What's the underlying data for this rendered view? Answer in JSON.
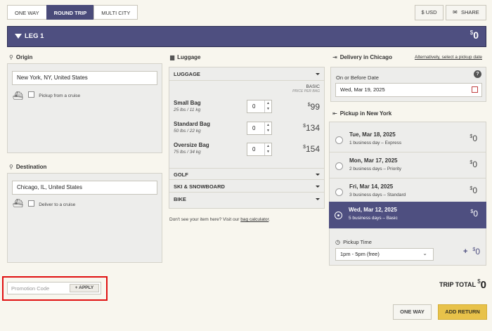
{
  "trip_tabs": [
    {
      "label": "ONE WAY",
      "active": false
    },
    {
      "label": "ROUND TRIP",
      "active": true
    },
    {
      "label": "MULTI CITY",
      "active": false
    }
  ],
  "currency_label": "$ USD",
  "share_label": "SHARE",
  "leg": {
    "title": "LEG 1",
    "price": "0",
    "currency_symbol": "$"
  },
  "origin": {
    "title": "Origin",
    "value": "New York, NY, United States",
    "cruise_label": "Pickup from a cruise"
  },
  "destination": {
    "title": "Destination",
    "value": "Chicago, IL, United States",
    "cruise_label": "Deliver to a cruise"
  },
  "luggage": {
    "title": "Luggage",
    "category": "LUGGAGE",
    "tier_label": "BASIC",
    "tier_sub": "PRICE PER BAG",
    "items": [
      {
        "name": "Small Bag",
        "weight": "25 lbs / 11 kg",
        "qty": "0",
        "price": "99"
      },
      {
        "name": "Standard Bag",
        "weight": "50 lbs / 22 kg",
        "qty": "0",
        "price": "134"
      },
      {
        "name": "Oversize Bag",
        "weight": "75 lbs / 34 kg",
        "qty": "0",
        "price": "154"
      }
    ],
    "other_categories": [
      "GOLF",
      "SKI & SNOWBOARD",
      "BIKE"
    ],
    "note_prefix": "Don't see your item here? Visit our",
    "note_link": "bag calculator",
    "note_suffix": "."
  },
  "delivery": {
    "title": "Delivery in Chicago",
    "alt_link": "Alternatively, select a pickup date",
    "label": "On or Before Date",
    "date_value": "Wed, Mar 19, 2025",
    "help": "?"
  },
  "pickup": {
    "title": "Pickup in New York",
    "options": [
      {
        "date": "Tue, Mar 18, 2025",
        "desc": "1 business day – Express",
        "price": "0",
        "selected": false
      },
      {
        "date": "Mon, Mar 17, 2025",
        "desc": "2 business days – Priority",
        "price": "0",
        "selected": false
      },
      {
        "date": "Fri, Mar 14, 2025",
        "desc": "3 business days – Standard",
        "price": "0",
        "selected": false
      },
      {
        "date": "Wed, Mar 12, 2025",
        "desc": "5 business days – Basic",
        "price": "0",
        "selected": true
      }
    ],
    "time_label": "Pickup Time",
    "time_value": "1pm - 5pm (free)",
    "time_plus": "+",
    "time_price": "0"
  },
  "promo": {
    "placeholder": "Promotion Code",
    "apply_label": "APPLY",
    "plus": "+"
  },
  "trip_total": {
    "label": "TRIP TOTAL",
    "price": "0"
  },
  "footer_buttons": {
    "one_way": "ONE WAY",
    "add_return": "ADD RETURN"
  },
  "colors": {
    "primary": "#4e4f80",
    "accent_yellow": "#e8c24a",
    "highlight_red": "#e01010",
    "background": "#f8f6ee"
  }
}
